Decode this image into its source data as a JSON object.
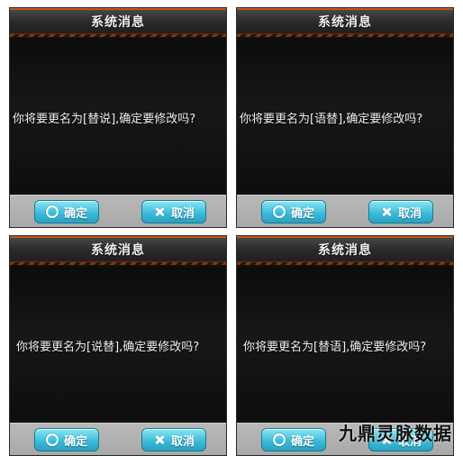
{
  "dialogs": [
    {
      "title": "系统消息",
      "message": "你将要更名为[替说],确定要修改吗?",
      "ok_label": "确定",
      "cancel_label": "取消"
    },
    {
      "title": "系统消息",
      "message": "你将要更名为[语替],确定要修改吗?",
      "ok_label": "确定",
      "cancel_label": "取消"
    },
    {
      "title": "系统消息",
      "message": "你将要更名为[说替],确定要修改吗?",
      "ok_label": "确定",
      "cancel_label": "取消"
    },
    {
      "title": "系统消息",
      "message": "你将要更名为[替语],确定要修改吗?",
      "ok_label": "确定",
      "cancel_label": "取消"
    }
  ],
  "watermark": "九鼎灵脉数据",
  "colors": {
    "button_gradient_top": "#8ae7f3",
    "button_gradient_bottom": "#2aa1c2",
    "title_accent": "#c4561a",
    "panel_background": "#111111"
  },
  "icons": {
    "ok": "circle-icon",
    "cancel": "x-icon"
  }
}
